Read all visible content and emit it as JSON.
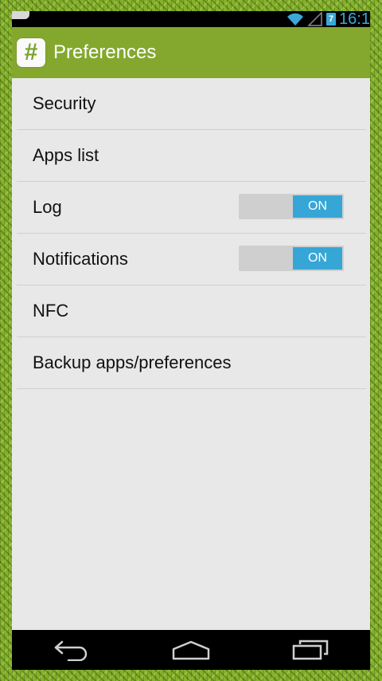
{
  "status_bar": {
    "time": "16:1",
    "battery_level": "7"
  },
  "action_bar": {
    "app_icon_glyph": "#",
    "title": "Preferences"
  },
  "preferences": [
    {
      "label": "Security"
    },
    {
      "label": "Apps list"
    },
    {
      "label": "Log",
      "toggle": "ON"
    },
    {
      "label": "Notifications",
      "toggle": "ON"
    },
    {
      "label": "NFC"
    },
    {
      "label": "Backup apps/preferences"
    }
  ],
  "nav_bar": {
    "buttons": [
      "back-icon",
      "home-icon",
      "recent-apps-icon"
    ]
  },
  "colors": {
    "accent": "#84a82e",
    "toggle_on": "#36a6d6",
    "background": "#e8e8e8"
  }
}
